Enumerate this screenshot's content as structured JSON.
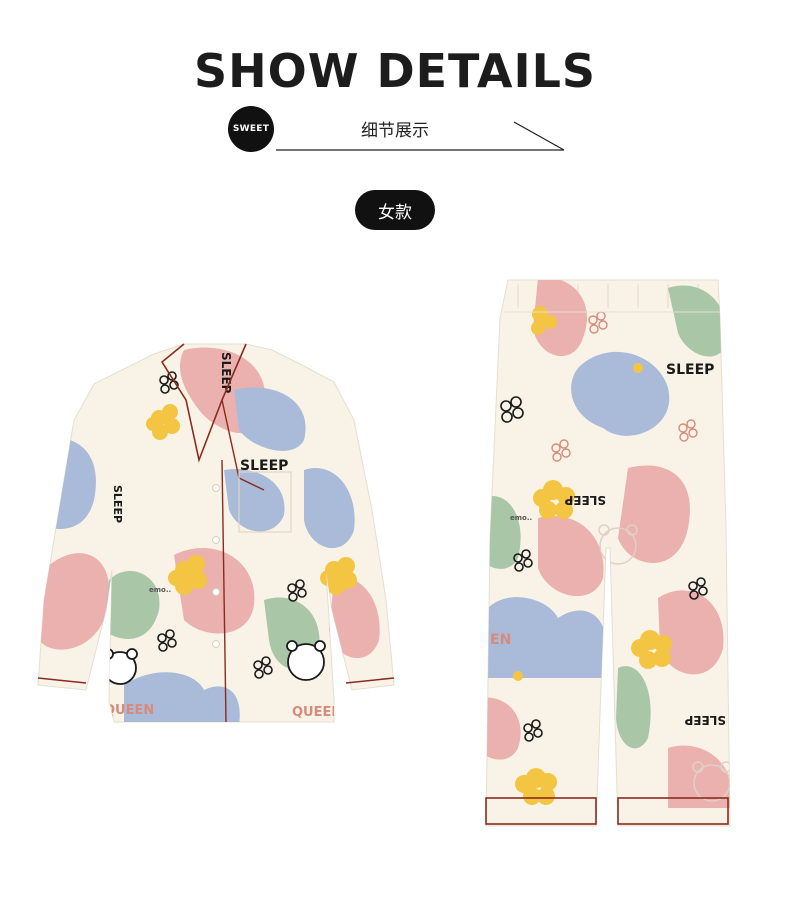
{
  "header": {
    "title": "SHOW DETAILS",
    "badge": "SWEET",
    "subtitle": "细节展示"
  },
  "category_pill": "女款",
  "print_text": {
    "sleep": "SLEEP",
    "queen": "QUEEN",
    "emo": "emo..",
    "en": "EN"
  },
  "colors": {
    "fabric": "#f8f3e6",
    "pink": "#eab1ae",
    "blue": "#a9bbd9",
    "green": "#a9c7a7",
    "yellow": "#f4c542",
    "piping": "#8a2b1f",
    "ink": "#1a1a1a"
  },
  "icons": [
    "flower-icon",
    "bear-icon",
    "cloud-icon"
  ]
}
